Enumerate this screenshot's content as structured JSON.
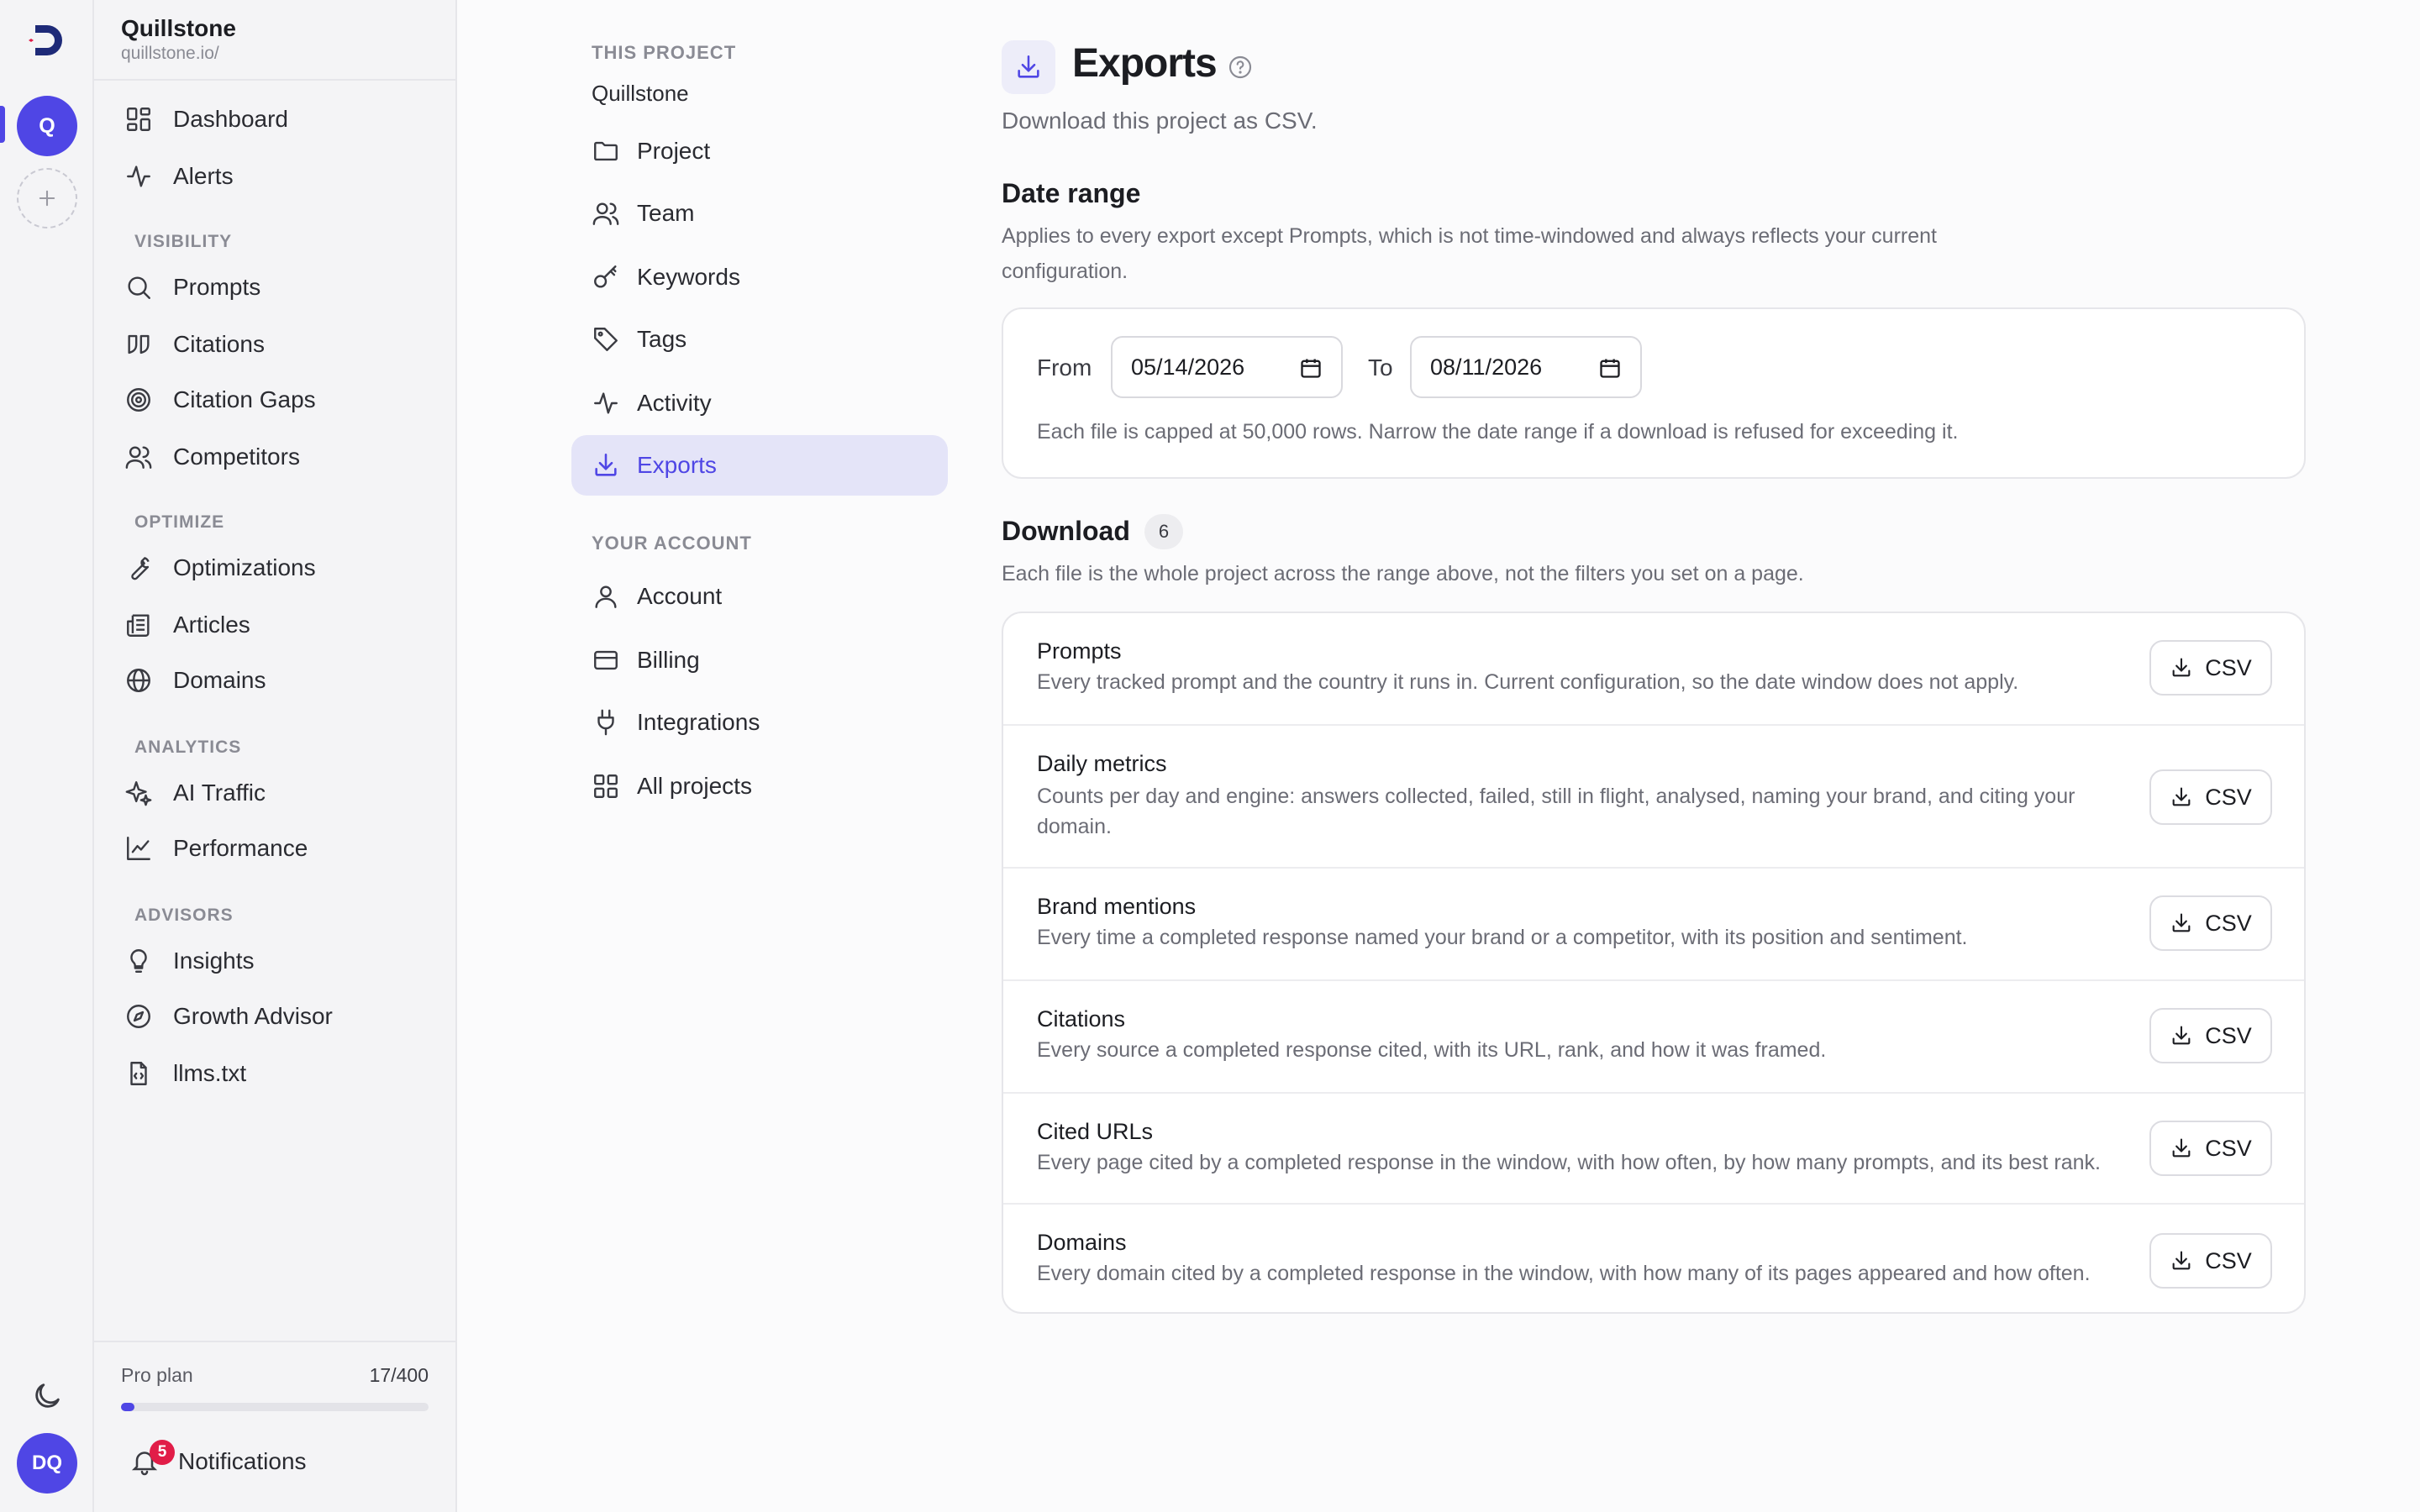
{
  "rail": {
    "project_initial": "Q",
    "user_initials": "DQ"
  },
  "project": {
    "name": "Quillstone",
    "url": "quillstone.io/"
  },
  "sidebar": {
    "top": [
      {
        "label": "Dashboard",
        "icon": "dashboard-icon"
      },
      {
        "label": "Alerts",
        "icon": "pulse-icon"
      }
    ],
    "visibility_title": "VISIBILITY",
    "visibility": [
      {
        "label": "Prompts",
        "icon": "search-icon"
      },
      {
        "label": "Citations",
        "icon": "quote-icon"
      },
      {
        "label": "Citation Gaps",
        "icon": "target-icon"
      },
      {
        "label": "Competitors",
        "icon": "users-icon"
      }
    ],
    "optimize_title": "OPTIMIZE",
    "optimize": [
      {
        "label": "Optimizations",
        "icon": "wrench-icon"
      },
      {
        "label": "Articles",
        "icon": "newspaper-icon"
      },
      {
        "label": "Domains",
        "icon": "globe-icon"
      }
    ],
    "analytics_title": "ANALYTICS",
    "analytics": [
      {
        "label": "AI Traffic",
        "icon": "sparkles-icon"
      },
      {
        "label": "Performance",
        "icon": "line-chart-icon"
      }
    ],
    "advisors_title": "ADVISORS",
    "advisors": [
      {
        "label": "Insights",
        "icon": "lightbulb-icon"
      },
      {
        "label": "Growth Advisor",
        "icon": "compass-icon"
      },
      {
        "label": "llms.txt",
        "icon": "file-code-icon"
      }
    ],
    "plan": {
      "label": "Pro plan",
      "count": "17/400",
      "usage_fraction": 0.0425
    },
    "notifications": {
      "label": "Notifications",
      "badge": "5"
    }
  },
  "settings_nav": {
    "project_section": "THIS PROJECT",
    "project_name": "Quillstone",
    "project_items": [
      {
        "label": "Project",
        "icon": "folder-icon"
      },
      {
        "label": "Team",
        "icon": "users-icon"
      },
      {
        "label": "Keywords",
        "icon": "key-icon"
      },
      {
        "label": "Tags",
        "icon": "tag-icon"
      },
      {
        "label": "Activity",
        "icon": "pulse-icon"
      },
      {
        "label": "Exports",
        "icon": "download-icon",
        "active": true
      }
    ],
    "account_section": "YOUR ACCOUNT",
    "account_items": [
      {
        "label": "Account",
        "icon": "user-icon"
      },
      {
        "label": "Billing",
        "icon": "credit-card-icon"
      },
      {
        "label": "Integrations",
        "icon": "plug-icon"
      },
      {
        "label": "All projects",
        "icon": "grid-icon"
      }
    ]
  },
  "page": {
    "title": "Exports",
    "subtitle": "Download this project as CSV.",
    "date_range": {
      "heading": "Date range",
      "description_line1": "Applies to every export except Prompts, which is not time-windowed and always reflects your current",
      "description_line2": "configuration.",
      "from_label": "From",
      "from_value": "05/14/2026",
      "to_label": "To",
      "to_value": "08/11/2026",
      "note": "Each file is capped at 50,000 rows. Narrow the date range if a download is refused for exceeding it."
    },
    "download": {
      "heading": "Download",
      "count": "6",
      "description": "Each file is the whole project across the range above, not the filters you set on a page.",
      "button_label": "CSV",
      "items": [
        {
          "title": "Prompts",
          "desc": "Every tracked prompt and the country it runs in. Current configuration, so the date window does not apply."
        },
        {
          "title": "Daily metrics",
          "desc": "Counts per day and engine: answers collected, failed, still in flight, analysed, naming your brand, and citing your domain."
        },
        {
          "title": "Brand mentions",
          "desc": "Every time a completed response named your brand or a competitor, with its position and sentiment."
        },
        {
          "title": "Citations",
          "desc": "Every source a completed response cited, with its URL, rank, and how it was framed."
        },
        {
          "title": "Cited URLs",
          "desc": "Every page cited by a completed response in the window, with how often, by how many prompts, and its best rank."
        },
        {
          "title": "Domains",
          "desc": "Every domain cited by a completed response in the window, with how many of its pages appeared and how often."
        }
      ]
    }
  },
  "colors": {
    "accent": "#4f46e5",
    "badge": "#e11d48",
    "active_bg": "#e4e4f8"
  }
}
